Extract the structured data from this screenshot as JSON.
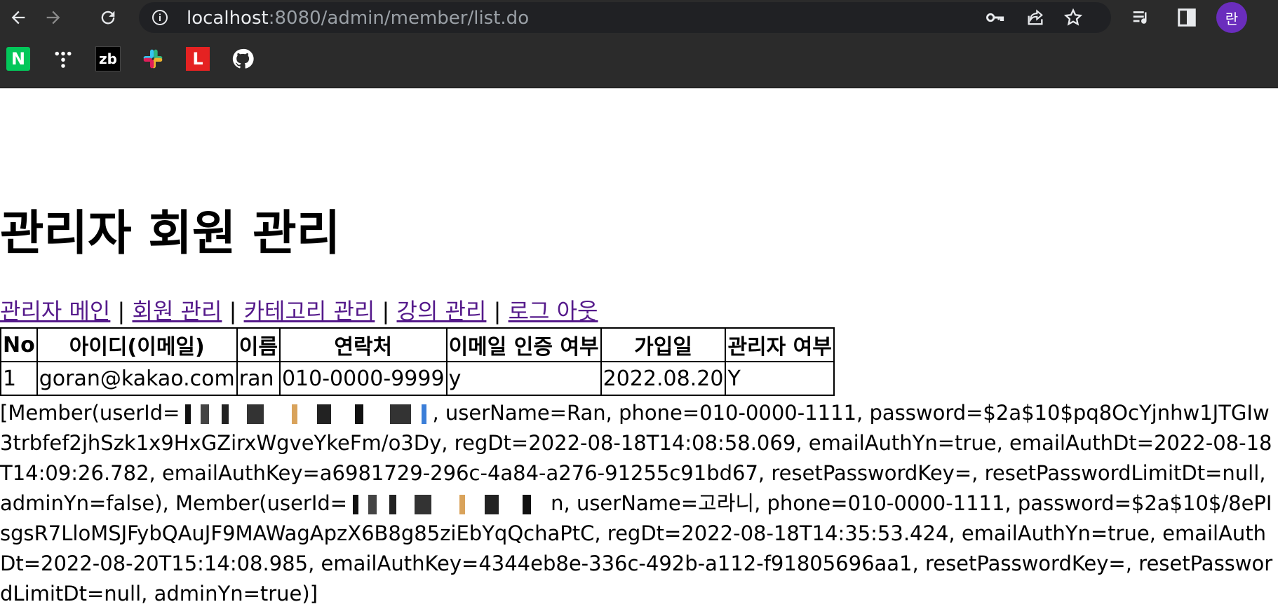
{
  "browser": {
    "url_host": "localhost",
    "url_rest": ":8080/admin/member/list.do",
    "profile_initial": "란",
    "nav_icons": [
      "back-arrow-icon",
      "forward-arrow-icon",
      "reload-icon"
    ],
    "omnibox_icons": [
      "site-info-icon",
      "key-icon",
      "share-icon",
      "star-icon"
    ],
    "toolbar_icons": [
      "reading-list-icon",
      "side-panel-icon"
    ],
    "bookmarks": [
      {
        "icon": "naver-icon",
        "text": "N",
        "color": "#03c75a"
      },
      {
        "icon": "dots-icon",
        "text": ""
      },
      {
        "icon": "zb-icon",
        "text": "zb",
        "color": "#000000"
      },
      {
        "icon": "slack-icon",
        "text": ""
      },
      {
        "icon": "l-icon",
        "text": "L",
        "color": "#e52222"
      },
      {
        "icon": "github-icon",
        "text": ""
      }
    ]
  },
  "page": {
    "title": "관리자 회원 관리",
    "links": [
      "관리자 메인",
      "회원 관리",
      "카테고리 관리",
      "강의 관리",
      "로그 아웃"
    ],
    "separator": "|",
    "table": {
      "headers": [
        "No",
        "아이디(이메일)",
        "이름",
        "연락처",
        "이메일 인증 여부",
        "가입일",
        "관리자 여부"
      ],
      "rows": [
        [
          "1",
          "goran@kakao.com",
          "ran",
          "010-0000-9999",
          "y",
          "2022.08.20",
          "Y"
        ]
      ]
    },
    "dump": {
      "part1": "[Member(userId=",
      "part2": ", userName=Ran, phone=010-0000-1111, password=$2a$10$pq8OcYjnhw1JTGIw3trbfef2jhSzk1x9HxGZirxWgveYkeFm/o3Dy, regDt=2022-08-18T14:08:58.069, emailAuthYn=true, emailAuthDt=2022-08-18T14:09:26.782, emailAuthKey=a6981729-296c-4a84-a276-91255c91bd67, resetPasswordKey=, resetPasswordLimitDt=null, adminYn=false), Member(userId=",
      "part3": "n, userName=고라니, phone=010-0000-1111, password=$2a$10$/8ePIsgsR7LloMSJFybQAuJF9MAWagApzX6B8g85ziEbYqQchaPtC, regDt=2022-08-18T14:35:53.424, emailAuthYn=true, emailAuthDt=2022-08-20T15:14:08.985, emailAuthKey=4344eb8e-336c-492b-a112-f91805696aa1, resetPasswordKey=, resetPasswordLimitDt=null, adminYn=true)]"
    }
  }
}
